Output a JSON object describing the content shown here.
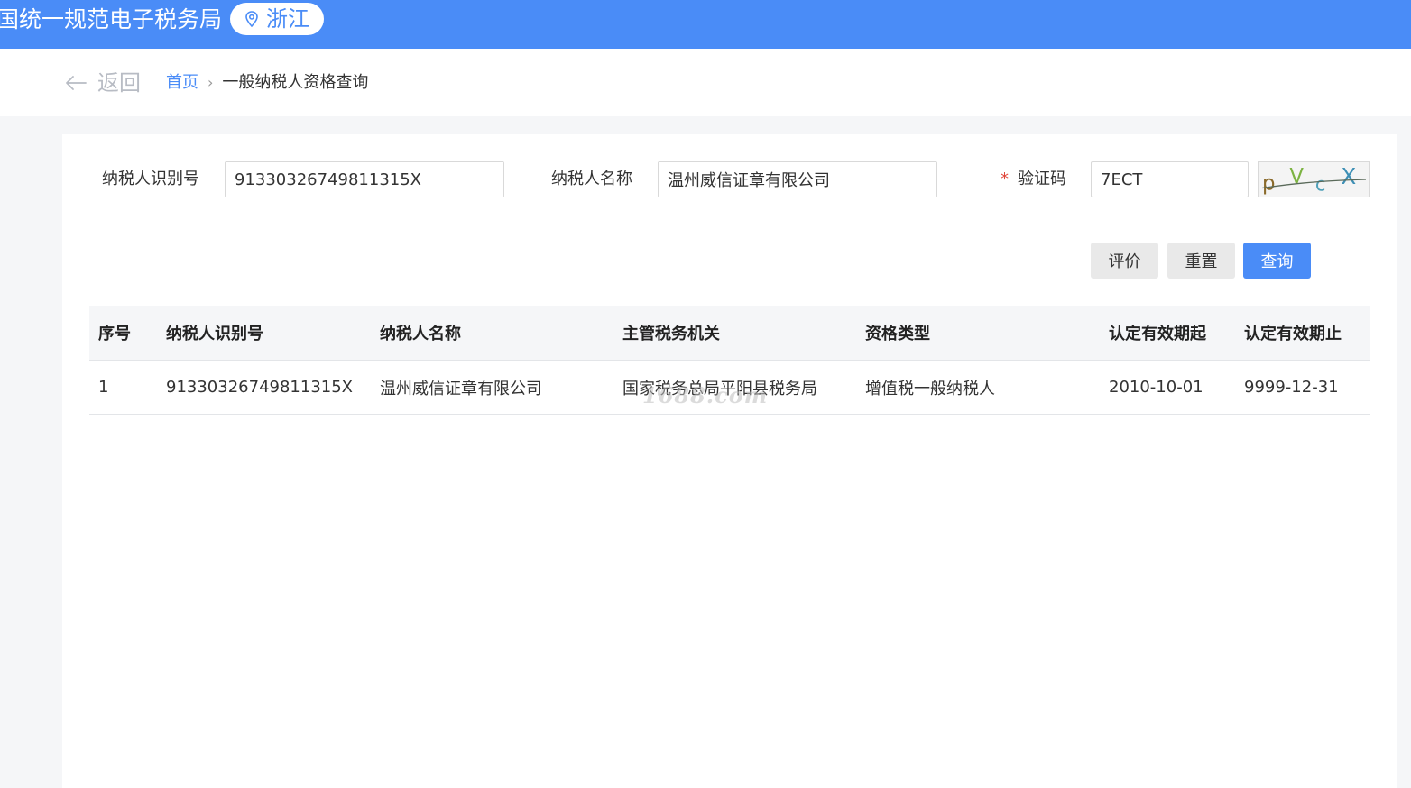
{
  "header": {
    "site_title": "国统一规范电子税务局",
    "province": "浙江",
    "location_icon": "location-pin-icon",
    "brand_color": "#4a8cf7"
  },
  "nav": {
    "back_label": "返回",
    "back_icon": "arrow-left-icon",
    "breadcrumb_home": "首页",
    "breadcrumb_sep": "›",
    "breadcrumb_current": "一般纳税人资格查询"
  },
  "form": {
    "taxpayer_id_label": "纳税人识别号",
    "taxpayer_id_value": "91330326749811315X",
    "taxpayer_name_label": "纳税人名称",
    "taxpayer_name_value": "温州威信证章有限公司",
    "required_mark": "*",
    "captcha_label": "验证码",
    "captcha_value": "7ECT",
    "captcha_image_text": "pVcX"
  },
  "buttons": {
    "evaluate": "评价",
    "reset": "重置",
    "query": "查询"
  },
  "table": {
    "columns": [
      "序号",
      "纳税人识别号",
      "纳税人名称",
      "主管税务机关",
      "资格类型",
      "认定有效期起",
      "认定有效期止"
    ],
    "rows": [
      [
        "1",
        "91330326749811315X",
        "温州威信证章有限公司",
        "国家税务总局平阳县税务局",
        "增值税一般纳税人",
        "2010-10-01",
        "9999-12-31"
      ]
    ]
  },
  "watermark": "1688.com"
}
